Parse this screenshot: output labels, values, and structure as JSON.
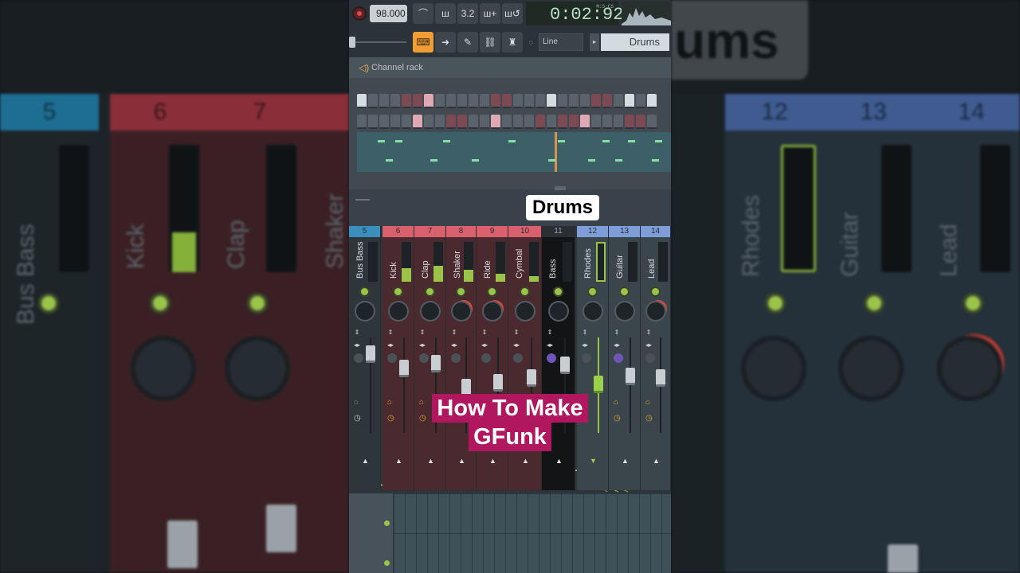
{
  "toolbar": {
    "tempo": "98.000",
    "time": "0:02:92",
    "time_units": "M:S:CS",
    "snap_mode": "Line",
    "pattern_name": "Drums",
    "icons": [
      "record-icon",
      "metronome-icon",
      "wait-icon",
      "countdown-icon",
      "step-edit-icon",
      "loop-record-icon",
      "piano-typing-icon",
      "arrow-icon",
      "brush-icon",
      "link-icon",
      "stamp-icon"
    ]
  },
  "channel_rack": {
    "title": "Channel rack"
  },
  "overlay": {
    "label": "Drums",
    "caption_line1": "How To Make",
    "caption_line2": "GFunk"
  },
  "mixer": {
    "channels": [
      {
        "num": "5",
        "name": "Bus Bass",
        "color": "#3a8fbf"
      },
      {
        "num": "6",
        "name": "Kick",
        "color": "#d9606c"
      },
      {
        "num": "7",
        "name": "Clap",
        "color": "#d9606c"
      },
      {
        "num": "8",
        "name": "Shaker",
        "color": "#d9606c"
      },
      {
        "num": "9",
        "name": "Ride",
        "color": "#d9606c"
      },
      {
        "num": "10",
        "name": "Cymbal",
        "color": "#d9606c"
      },
      {
        "num": "11",
        "name": "Bass",
        "color": "#2b2f33"
      },
      {
        "num": "12",
        "name": "Rhodes",
        "color": "#7f9dd8"
      },
      {
        "num": "13",
        "name": "Guitar",
        "color": "#7f9dd8"
      },
      {
        "num": "14",
        "name": "Lead",
        "color": "#7f9dd8"
      }
    ]
  },
  "background": {
    "left_channels": [
      {
        "num": "5",
        "name": "Bus Bass"
      },
      {
        "num": "6",
        "name": "Kick"
      },
      {
        "num": "7",
        "name": "Clap"
      },
      {
        "num": "",
        "name": "Shaker"
      }
    ],
    "right_channels": [
      {
        "num": "12",
        "name": "Rhodes"
      },
      {
        "num": "13",
        "name": "Guitar"
      },
      {
        "num": "14",
        "name": "Lead"
      }
    ],
    "banner_text": "ums"
  },
  "colors": {
    "accent": "#ef9e35",
    "meter": "#9ac34a",
    "caption_bg": "#b0175f",
    "drum_group": "#d9606c",
    "synth_group": "#7f9dd8"
  }
}
